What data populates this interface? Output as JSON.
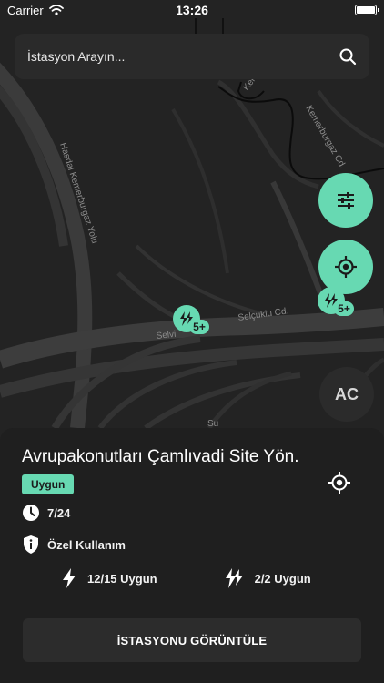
{
  "status_bar": {
    "carrier": "Carrier",
    "time": "13:26",
    "battery_level": 1.0
  },
  "search": {
    "placeholder": "İstasyon Arayın..."
  },
  "map": {
    "road_labels": [
      "Hasdal Kemerburgaz Yolu",
      "Kemerburgaz Cd.",
      "Keme",
      "Selçuklu Cd.",
      "Selvi",
      "Su"
    ],
    "markers": [
      {
        "badge": "5+"
      },
      {
        "badge": "5+"
      }
    ]
  },
  "controls": {
    "ac_label": "AC"
  },
  "station": {
    "name": "Avrupakonutları Çamlıvadi Site Yön.",
    "status": "Uygun",
    "hours": "7/24",
    "access": "Özel Kullanım",
    "connectors": [
      {
        "icon": "bolt-icon",
        "availability": "12/15 Uygun"
      },
      {
        "icon": "double-bolt-icon",
        "availability": "2/2 Uygun"
      }
    ],
    "view_button": "İSTASYONU GÖRÜNTÜLE"
  },
  "colors": {
    "accent": "#67d9b2",
    "background": "#1f1f1f",
    "map": "#232323"
  }
}
